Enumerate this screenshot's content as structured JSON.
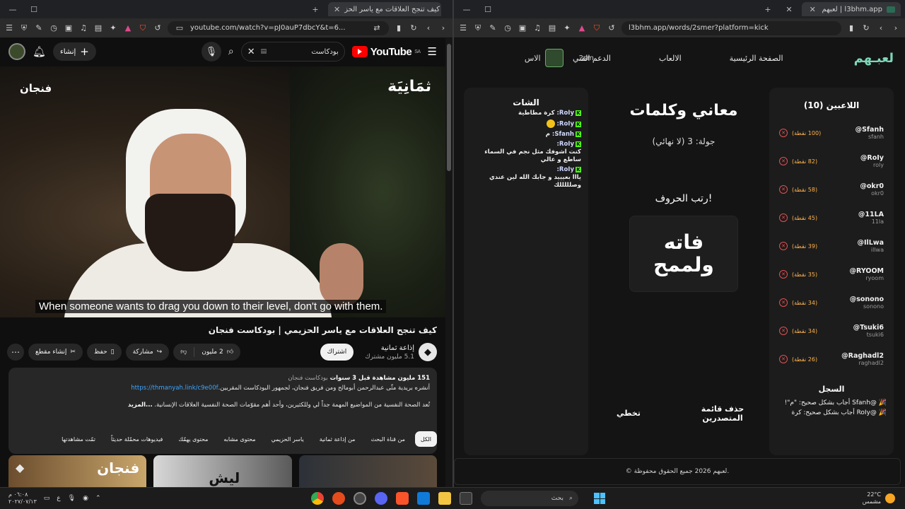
{
  "left_window": {
    "tab_title": "كيف تنجح العلاقات مع ياسر الحز",
    "url": "youtube.com/watch?v=pJ0auP7dbcY&t=6...",
    "youtube": {
      "logo": "YouTube",
      "region": "SA",
      "search_query": "بودكاست",
      "create_label": "إنشاء",
      "video": {
        "brand_left": "فنجان",
        "brand_right": "ثمَانِيَة",
        "caption": "When someone wants to drag you down to their level, don't go with them."
      },
      "title": "كيف تنجح العلاقات مع ياسر الحزيمي | بودكاست فنجان",
      "channel": {
        "name": "إذاعة ثمانية",
        "subscribers": "5.1 مليون مشترك",
        "subscribe_label": "اشتراك"
      },
      "actions": {
        "likes": "2 مليون",
        "share": "مشاركة",
        "save": "حفظ",
        "clip": "إنشاء مقطع"
      },
      "description": {
        "meta": "151 مليون مشاهدة  قبل 3 سنوات",
        "meta_tag": "بودكاست فنجان",
        "line1_prefix": "أنشره بريدية مثّى عبدالرحمن أبومالح ومن فريق فنجان، لجمهور البودكاست المقربين.",
        "line1_link": "https://thmanyah.link/c9e00f",
        "line2": "تُعد الصحة النفسية من المواضيع المهمة جداً لي وللكثيرين، وأحد أهم مقوّمات الصحة النفسية العلاقات الإنسانية. ",
        "more": "...المزيد"
      },
      "chips": [
        "الكل",
        "من قناة البحث",
        "من إذاعة ثمانية",
        "ياسر الحزيمي",
        "محتوى مشابه",
        "محتوى يهمّك",
        "فيديوهات محمّلة حديثاً",
        "تمّت مشاهدتها"
      ],
      "thumbnails": [
        {
          "text": "فنجان",
          "color": "#c9a66b"
        },
        {
          "text": "ليش",
          "color": "#8a8a8a"
        },
        {
          "text": "",
          "color": "#3a3f46"
        }
      ]
    }
  },
  "right_window": {
    "tab_title": "لعبهم | l3bhm.app",
    "url": "l3bhm.app/words/2smer?platform=kick",
    "site": {
      "logo": "لعبـهم",
      "nav": [
        "الصفحة الرئيسية",
        "الالعاب",
        "الدعم الفني"
      ],
      "nav_cut": "الاس",
      "nav_user": "2sm",
      "players_title": "اللاعبين (10)",
      "players": [
        {
          "handle": "@Sfanh",
          "sub": "sfanh",
          "points": "(100 نقطة)"
        },
        {
          "handle": "@RoIy",
          "sub": "roly",
          "points": "(82 نقطة)"
        },
        {
          "handle": "@okr0",
          "sub": "okr0",
          "points": "(58 نقطة)"
        },
        {
          "handle": "@11LA",
          "sub": "11la",
          "points": "(45 نقطة)"
        },
        {
          "handle": "@IlLwa",
          "sub": "illwa",
          "points": "(39 نقطة)"
        },
        {
          "handle": "@RYOOM",
          "sub": "ryoom",
          "points": "(35 نقطة)"
        },
        {
          "handle": "@sonono",
          "sub": "sonono",
          "points": "(34 نقطة)"
        },
        {
          "handle": "@Tsuki6",
          "sub": "tsuki6",
          "points": "(34 نقطة)"
        },
        {
          "handle": "@Raghadl2",
          "sub": "raghadl2",
          "points": "(26 نقطة)"
        }
      ],
      "log_title": "السجل",
      "log": [
        "🎉 @Sfanh أجاب بشكل صحيح: \"م\"!",
        "🎉 @RoIy أجاب بشكل صحيح: كرة"
      ],
      "game_title": "معاني وكلمات",
      "round": "جولة: 3 (لا نهائي)",
      "instruction": "رتب الحروف!",
      "word_line1": "فاته",
      "word_line2": "ولممح",
      "btn_delete": "حذف قائمة المتصدرين",
      "btn_skip": "تخطي",
      "chat_title": "الشات",
      "chat": [
        {
          "user": "RoIy:",
          "text": "كرة مطاطية"
        },
        {
          "user": "RoIy:",
          "text": ""
        },
        {
          "user": "Sfanh:",
          "text": "م"
        },
        {
          "user": "RoIy:",
          "text": "كنت اشوفك مثل نجم في السماء ساطع و عالي"
        },
        {
          "user": "RoIy:",
          "text": "يااا بعيييد و جابك الله لين عندي وصلللللك"
        }
      ],
      "footer": "© لعبهم 2026 جميع الحقوق محفوظة."
    }
  },
  "taskbar": {
    "time": "٠٦:٠٨ م",
    "date": "٢٠٢٧/٠٧/١٣",
    "lang": "ع",
    "search": "بحث",
    "temp": "22°C",
    "weather": "مشمس"
  }
}
